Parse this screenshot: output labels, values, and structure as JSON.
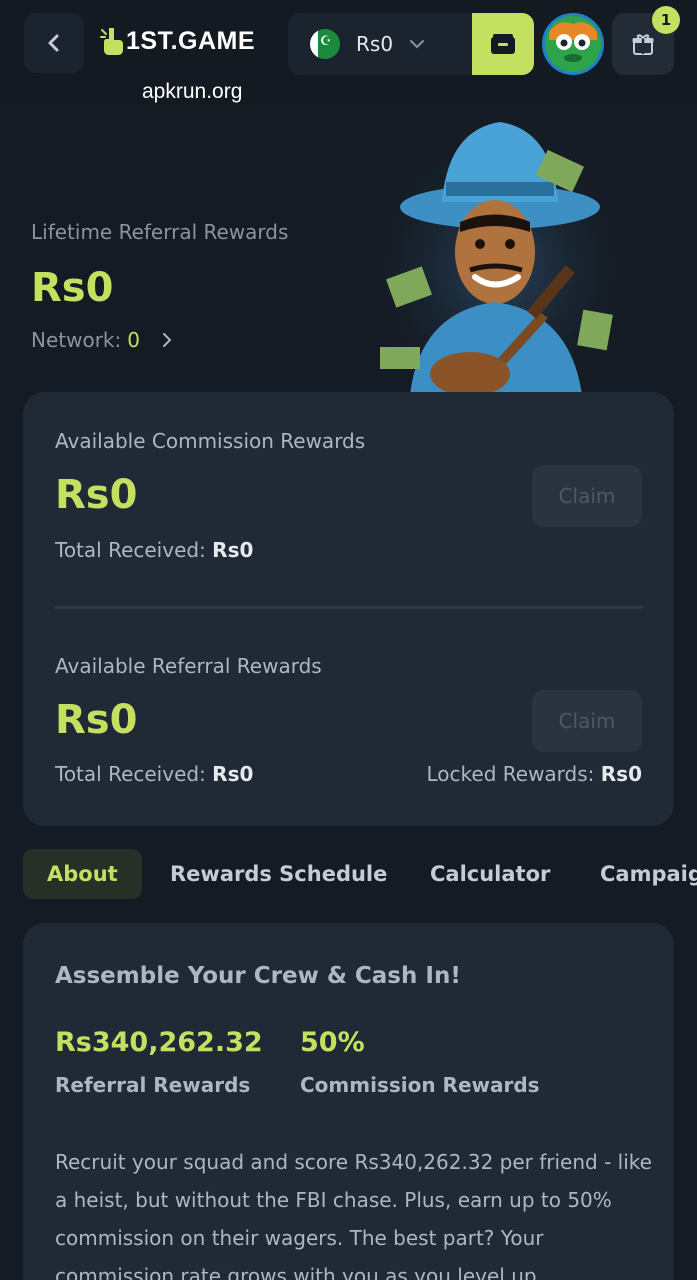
{
  "header": {
    "logo_text": "1ST.GAME",
    "watermark": "apkrun.org",
    "balance": "Rs0",
    "notification_count": "1"
  },
  "hero": {
    "label": "Lifetime Referral Rewards",
    "amount": "Rs0",
    "network_label": "Network:",
    "network_value": "0"
  },
  "commission": {
    "label": "Available Commission Rewards",
    "amount": "Rs0",
    "claim_label": "Claim",
    "total_label": "Total Received:",
    "total_value": "Rs0"
  },
  "referral": {
    "label": "Available Referral Rewards",
    "amount": "Rs0",
    "claim_label": "Claim",
    "total_label": "Total Received:",
    "total_value": "Rs0",
    "locked_label": "Locked Rewards:",
    "locked_value": "Rs0"
  },
  "tabs": [
    {
      "label": "About"
    },
    {
      "label": "Rewards Schedule"
    },
    {
      "label": "Calculator"
    },
    {
      "label": "Campaigns"
    }
  ],
  "about": {
    "title": "Assemble Your Crew & Cash In!",
    "stat1_value": "Rs340,262.32",
    "stat1_label": "Referral Rewards",
    "stat2_value": "50%",
    "stat2_label": "Commission Rewards",
    "body": "Recruit your squad and score Rs340,262.32 per friend - like a heist, but without the FBI chase. Plus, earn up to 50% commission on their wagers. The best part? Your commission rate grows with you as you level up"
  },
  "colors": {
    "accent": "#c5e060",
    "background": "#151b24",
    "card": "#202a36"
  }
}
